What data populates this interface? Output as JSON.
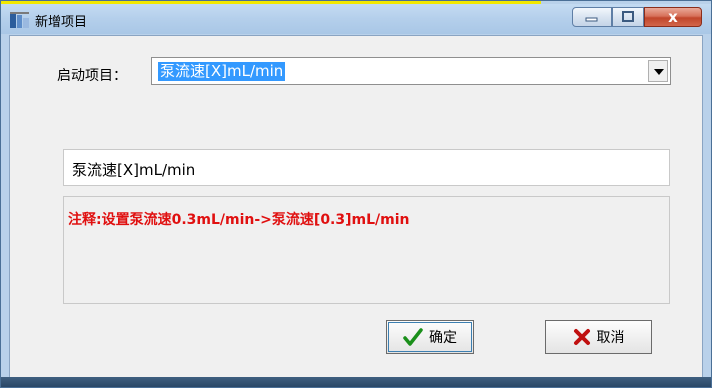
{
  "window": {
    "title": "新增项目",
    "close_glyph": "x",
    "icons": {
      "app": "app-icon",
      "minimize": "minimize-icon",
      "maximize": "maximize-icon",
      "close": "close-icon"
    }
  },
  "form": {
    "start_label": "启动项目：",
    "combo_value": "泵流速[X]mL/min",
    "text_value": "泵流速[X]mL/min",
    "note": "注释:设置泵流速0.3mL/min->泵流速[0.3]mL/min"
  },
  "buttons": {
    "ok_label": "确定",
    "cancel_label": "取消",
    "ok_icon": "checkmark-icon",
    "cancel_icon": "x-mark-icon"
  },
  "colors": {
    "note_text": "#e01010",
    "selection": "#3399ff",
    "ok_check": "#1a8f1a",
    "cancel_x": "#c01010"
  }
}
